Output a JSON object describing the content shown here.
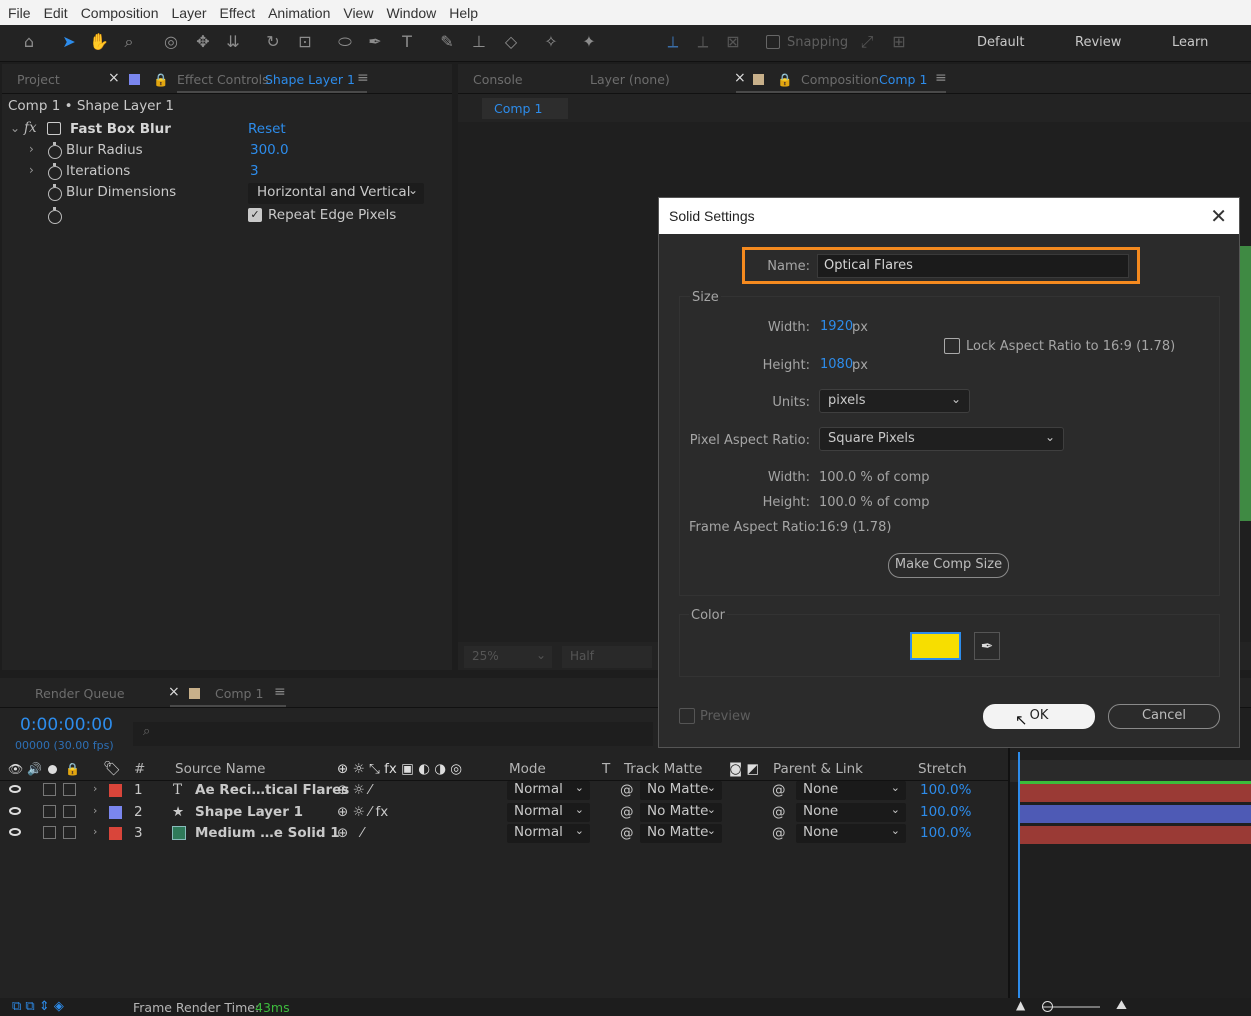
{
  "menu": [
    "File",
    "Edit",
    "Composition",
    "Layer",
    "Effect",
    "Animation",
    "View",
    "Window",
    "Help"
  ],
  "toolbar": {
    "snapping_label": "Snapping",
    "workspaces": [
      "Default",
      "Review",
      "Learn"
    ]
  },
  "left_panel": {
    "tabs": {
      "project": "Project",
      "effect_controls": "Effect Controls",
      "effect_controls_layer": "Shape Layer 1"
    },
    "breadcrumb": "Comp 1 • Shape Layer 1",
    "effect": {
      "name": "Fast Box Blur",
      "reset": "Reset"
    },
    "params": [
      {
        "label": "Blur Radius",
        "value": "300.0"
      },
      {
        "label": "Iterations",
        "value": "3"
      },
      {
        "label": "Blur Dimensions",
        "value": "Horizontal and Vertical"
      }
    ],
    "repeat_edge": "Repeat Edge Pixels"
  },
  "viewer": {
    "tabs": {
      "console": "Console",
      "layer": "Layer (none)",
      "composition": "Composition",
      "comp_name": "Comp 1"
    },
    "comp_chip": "Comp 1",
    "zoom": "25%",
    "resolution": "Half"
  },
  "dialog": {
    "title": "Solid Settings",
    "name_label": "Name:",
    "name_value": "Optical Flares",
    "size_group": "Size",
    "width_label": "Width:",
    "width_value": "1920",
    "height_label": "Height:",
    "height_value": "1080",
    "px": "px",
    "lock_label": "Lock Aspect Ratio to 16:9 (1.78)",
    "units_label": "Units:",
    "units_value": "pixels",
    "par_label": "Pixel Aspect Ratio:",
    "par_value": "Square Pixels",
    "pct_width_label": "Width:",
    "pct_width_value": "100.0 % of comp",
    "pct_height_label": "Height:",
    "pct_height_value": "100.0 % of comp",
    "far_label": "Frame Aspect Ratio:",
    "far_value": "16:9 (1.78)",
    "make_comp_size": "Make Comp Size",
    "color_group": "Color",
    "color_hex": "#f7de00",
    "preview_label": "Preview",
    "ok": "OK",
    "cancel": "Cancel"
  },
  "bottom_tabs": {
    "render_queue": "Render Queue",
    "comp": "Comp 1"
  },
  "timeline": {
    "timecode": "0:00:00:00",
    "fps": "00000 (30.00 fps)",
    "headers": {
      "num": "#",
      "source": "Source Name",
      "mode": "Mode",
      "t": "T",
      "track_matte": "Track Matte",
      "parent": "Parent & Link",
      "stretch": "Stretch"
    },
    "layers": [
      {
        "num": "1",
        "name": "Ae Reci…tical Flares",
        "mode": "Normal",
        "matte": "No Matte",
        "parent": "None",
        "stretch": "100.0%",
        "color": "#d9453a",
        "type_icon": "text-icon"
      },
      {
        "num": "2",
        "name": "Shape Layer 1",
        "mode": "Normal",
        "matte": "No Matte",
        "parent": "None",
        "stretch": "100.0%",
        "color": "#7a86ee",
        "type_icon": "star-icon"
      },
      {
        "num": "3",
        "name": "Medium …e Solid 1",
        "mode": "Normal",
        "matte": "No Matte",
        "parent": "None",
        "stretch": "100.0%",
        "color": "#d9453a",
        "type_icon": "solid-icon"
      }
    ]
  },
  "status": {
    "render_time_label": "Frame Render Time:",
    "render_time": "43ms"
  }
}
